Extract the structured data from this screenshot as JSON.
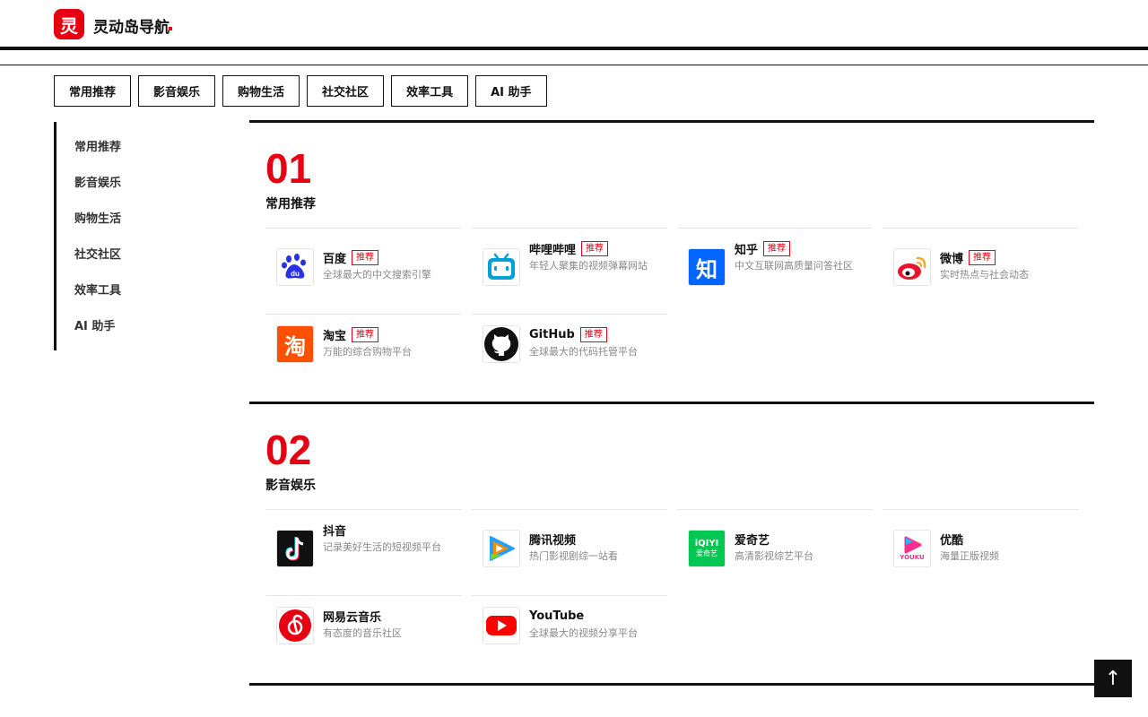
{
  "header": {
    "logo_char": "灵",
    "logo_text": "灵动岛导航"
  },
  "tabs": [
    "常用推荐",
    "影音娱乐",
    "购物生活",
    "社交社区",
    "效率工具",
    "AI 助手"
  ],
  "sidebar": [
    "常用推荐",
    "影音娱乐",
    "购物生活",
    "社交社区",
    "效率工具",
    "AI 助手"
  ],
  "sections": [
    {
      "num": "01",
      "title": "常用推荐",
      "cards": [
        {
          "name": "百度",
          "badge": "推荐",
          "desc": "全球最大的中文搜索引擎",
          "icon": "baidu-icon"
        },
        {
          "name": "哔哩哔哩",
          "badge": "推荐",
          "desc": "年轻人聚集的视频弹幕网站",
          "icon": "bilibili-icon"
        },
        {
          "name": "知乎",
          "badge": "推荐",
          "desc": "中文互联网高质量问答社区",
          "icon": "zhihu-icon"
        },
        {
          "name": "微博",
          "badge": "推荐",
          "desc": "实时热点与社会动态",
          "icon": "weibo-icon"
        },
        {
          "name": "淘宝",
          "badge": "推荐",
          "desc": "万能的综合购物平台",
          "icon": "taobao-icon"
        },
        {
          "name": "GitHub",
          "badge": "推荐",
          "desc": "全球最大的代码托管平台",
          "icon": "github-icon"
        }
      ]
    },
    {
      "num": "02",
      "title": "影音娱乐",
      "cards": [
        {
          "name": "抖音",
          "desc": "记录美好生活的短视频平台",
          "icon": "douyin-icon"
        },
        {
          "name": "腾讯视频",
          "desc": "热门影视剧综一站看",
          "icon": "tencent-video-icon"
        },
        {
          "name": "爱奇艺",
          "desc": "高清影视综艺平台",
          "icon": "iqiyi-icon",
          "icon_text": "iQIYI",
          "icon_sub": "爱奇艺"
        },
        {
          "name": "优酷",
          "desc": "海量正版视频",
          "icon": "youku-icon",
          "icon_text": "YOUKU"
        },
        {
          "name": "网易云音乐",
          "desc": "有态度的音乐社区",
          "icon": "netease-music-icon"
        },
        {
          "name": "YouTube",
          "desc": "全球最大的视频分享平台",
          "icon": "youtube-icon"
        }
      ]
    }
  ],
  "back_to_top": "↑",
  "colors": {
    "accent": "#e60012",
    "text": "#111111",
    "muted": "#888888"
  }
}
